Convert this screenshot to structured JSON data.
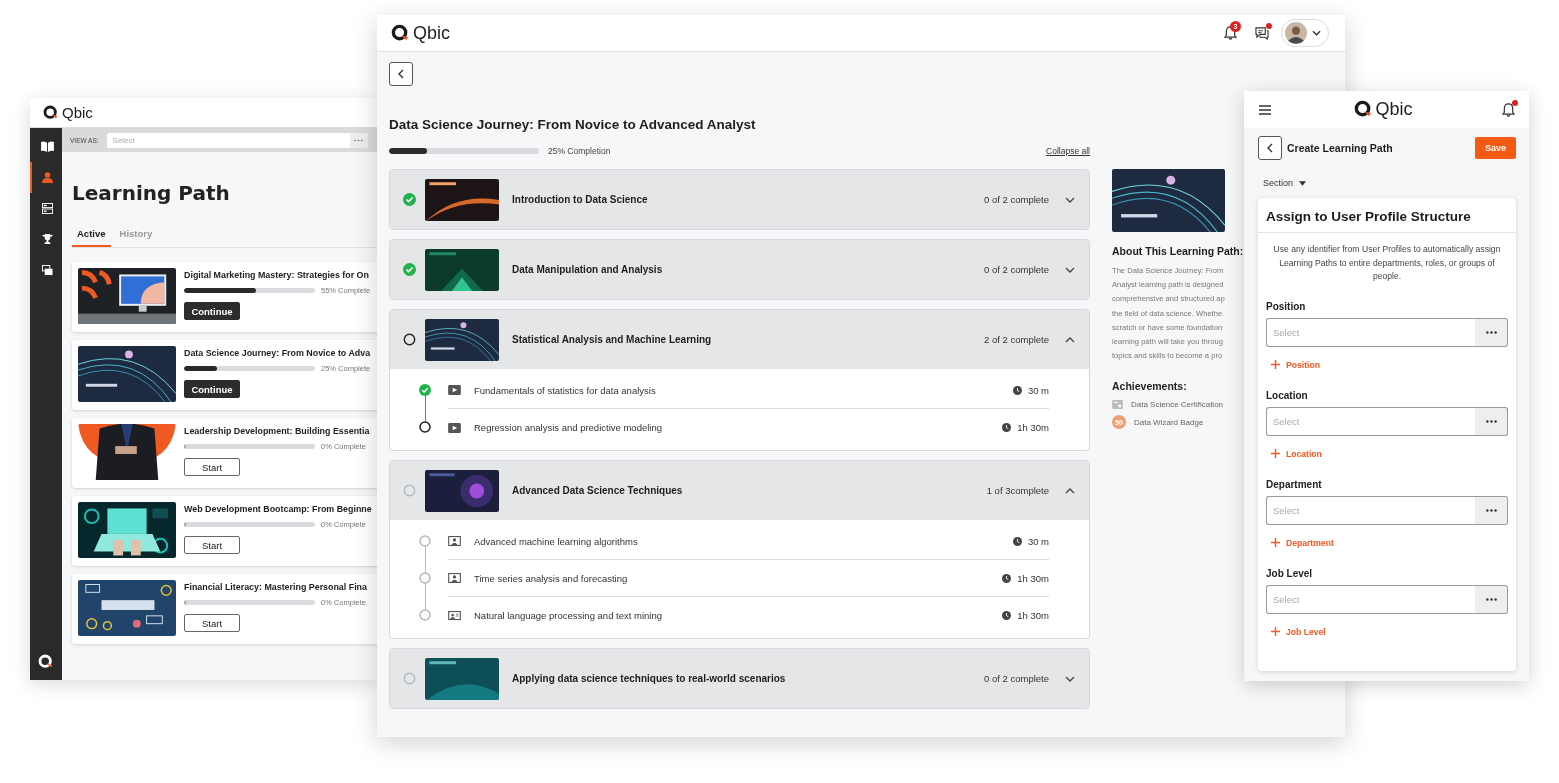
{
  "left_window": {
    "logo": "Qbic",
    "sidebar": [
      {
        "selected": false
      },
      {
        "selected": true
      },
      {
        "selected": false
      },
      {
        "selected": false
      },
      {
        "selected": false
      }
    ],
    "view_as": {
      "label": "VIEW AS:",
      "placeholder": "Select"
    },
    "title": "Learning Path",
    "tabs": [
      {
        "label": "Active",
        "selected": true
      },
      {
        "label": "History",
        "selected": false
      }
    ],
    "courses": [
      {
        "title": "Digital Marketing Mastery: Strategies for On",
        "level": 0.55,
        "reading": "55% Complete",
        "action": "Continue",
        "kind": "filled"
      },
      {
        "title": "Data Science Journey: From Novice to Adva",
        "level": 0.25,
        "reading": "25% Complete",
        "action": "Continue",
        "kind": "filled"
      },
      {
        "title": "Leadership Development: Building Essentia",
        "level": 0,
        "reading": "0% Complete",
        "action": "Start",
        "kind": "outline"
      },
      {
        "title": "Web Development Bootcamp: From Beginne",
        "level": 0,
        "reading": "0% Complete",
        "action": "Start",
        "kind": "outline"
      },
      {
        "title": "Financial Literacy: Mastering Personal Fina",
        "level": 0,
        "reading": "0% Complete",
        "action": "Start",
        "kind": "outline"
      }
    ]
  },
  "main_window": {
    "logo": "Qbic",
    "notifications": "3",
    "messages_unread": true,
    "title": "Data Science Journey: From Novice to Advanced Analyst",
    "level": 0.25,
    "reading": "25% Completion",
    "collapse": "Collapse all",
    "modules": [
      {
        "done": true,
        "current": false,
        "title": "Introduction to Data Science",
        "count": "0 of 2 complete",
        "expanded": false
      },
      {
        "done": true,
        "current": false,
        "title": "Data Manipulation and Analysis",
        "count": "0 of 2 complete",
        "expanded": false
      },
      {
        "done": false,
        "current": true,
        "title": "Statistical Analysis and Machine Learning",
        "count": "2 of 2 complete",
        "expanded": true,
        "lessons": [
          {
            "done": true,
            "current": false,
            "kind": "video",
            "title": "Fundamentals of statistics for data analysis",
            "duration": "30 m"
          },
          {
            "done": false,
            "current": true,
            "kind": "video",
            "title": "Regression analysis and predictive modeling",
            "duration": "1h 30m"
          }
        ]
      },
      {
        "done": false,
        "current": false,
        "title": "Advanced Data Science Techniques",
        "count": "1 of 3complete",
        "expanded": true,
        "lessons": [
          {
            "done": false,
            "current": false,
            "kind": "classroom",
            "title": "Advanced machine learning algorithms",
            "duration": "30 m"
          },
          {
            "done": false,
            "current": false,
            "kind": "classroom",
            "title": "Time series analysis and forecasting",
            "duration": "1h 30m"
          },
          {
            "done": false,
            "current": false,
            "kind": "screen",
            "title": "Natural language processing and text mining",
            "duration": "1h 30m"
          }
        ]
      },
      {
        "done": false,
        "current": false,
        "title": "Applying data science techniques to real-world scenarios",
        "count": "0 of 2 complete",
        "expanded": false
      }
    ],
    "about": {
      "title": "About This Learning Path:",
      "lines": [
        "The Data Science Journey: From",
        "Analyst learning path is designed",
        "comprehensive and structured ap",
        "the field of data science. Whethe",
        "scratch or have some foundation",
        "learning path will take you throug",
        "topics and skills to become a pro"
      ]
    },
    "achievements_title": "Achievements:",
    "achievements": [
      {
        "kind": "certificate",
        "label": "Data Science Certification"
      },
      {
        "kind": "badge",
        "badge_text": "50",
        "label": "Data Wizard Badge"
      }
    ]
  },
  "mobile_window": {
    "logo": "Qbic",
    "bell_unread": true,
    "title": "Create Learning Path",
    "save": "Save",
    "section": "Section",
    "card_title": "Assign to User Profile Structure",
    "description": "Use any identifier from User Profiles to automatically assign Learning Paths to entire departments, roles, or groups of people.",
    "fields": [
      {
        "label": "Position",
        "placeholder": "Select",
        "add": "Position"
      },
      {
        "label": "Location",
        "placeholder": "Select",
        "add": "Location"
      },
      {
        "label": "Department",
        "placeholder": "Select",
        "add": "Department"
      },
      {
        "label": "Job Level",
        "placeholder": "Select",
        "add": "Job Level"
      }
    ]
  }
}
